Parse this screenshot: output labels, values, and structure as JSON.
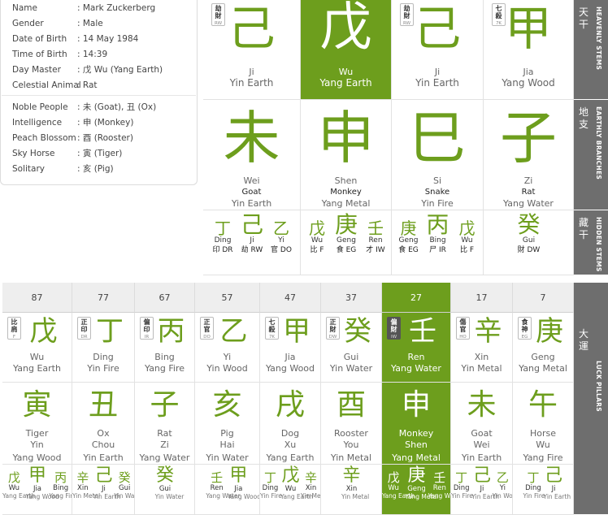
{
  "profile": [
    {
      "label": "Name",
      "value": ": Mark Zuckerberg"
    },
    {
      "label": "Gender",
      "value": ": Male"
    },
    {
      "label": "Date of Birth",
      "value": ": 14 May 1984"
    },
    {
      "label": "Time of Birth",
      "value": ": 14:39"
    },
    {
      "label": "Day Master",
      "value": ": 戊 Wu  (Yang Earth)"
    },
    {
      "label": "Celestial Animal",
      "value": ": Rat"
    }
  ],
  "stars": [
    {
      "label": "Noble People",
      "value": ": 未 (Goat),  丑 (Ox)"
    },
    {
      "label": "Intelligence",
      "value": ": 申 (Monkey)"
    },
    {
      "label": "Peach Blossom",
      "value": ": 酉 (Rooster)"
    },
    {
      "label": "Sky Horse",
      "value": ": 寅 (Tiger)"
    },
    {
      "label": "Solitary",
      "value": ": 亥 (Pig)"
    }
  ],
  "sidebar": {
    "heavenly": {
      "cjk": "天干",
      "en": "HEAVENLY STEMS"
    },
    "earthly": {
      "cjk": "地支",
      "en": "EARTHLY BRANCHES"
    },
    "hidden": {
      "cjk": "藏干",
      "en": "HIDDEN STEMS"
    },
    "luck": {
      "cjk": "大運",
      "en": "LUCK PILLARS"
    }
  },
  "heavenly_stems": [
    {
      "char": "己",
      "pinyin": "Ji",
      "element": "Yin Earth",
      "badge": {
        "c": "劫財",
        "s": "RW"
      }
    },
    {
      "char": "戊",
      "pinyin": "Wu",
      "element": "Yang Earth",
      "highlight": true
    },
    {
      "char": "己",
      "pinyin": "Ji",
      "element": "Yin Earth",
      "badge": {
        "c": "劫財",
        "s": "RW"
      }
    },
    {
      "char": "甲",
      "pinyin": "Jia",
      "element": "Yang Wood",
      "badge": {
        "c": "七殺",
        "s": "7K"
      }
    }
  ],
  "earthly_branches": [
    {
      "char": "未",
      "pinyin": "Wei",
      "animal": "Goat",
      "element": "Yin Earth"
    },
    {
      "char": "申",
      "pinyin": "Shen",
      "animal": "Monkey",
      "element": "Yang Metal"
    },
    {
      "char": "巳",
      "pinyin": "Si",
      "animal": "Snake",
      "element": "Yin Fire"
    },
    {
      "char": "子",
      "pinyin": "Zi",
      "animal": "Rat",
      "element": "Yang Water"
    }
  ],
  "hidden_stems": [
    [
      {
        "char": "丁",
        "pinyin": "Ding",
        "god": "印 DR"
      },
      {
        "char": "己",
        "pinyin": "Ji",
        "god": "劫 RW"
      },
      {
        "char": "乙",
        "pinyin": "Yi",
        "god": "官 DO"
      }
    ],
    [
      {
        "char": "戊",
        "pinyin": "Wu",
        "god": "比 F"
      },
      {
        "char": "庚",
        "pinyin": "Geng",
        "god": "食 EG"
      },
      {
        "char": "壬",
        "pinyin": "Ren",
        "god": "才 IW"
      }
    ],
    [
      {
        "char": "庚",
        "pinyin": "Geng",
        "god": "食 EG"
      },
      {
        "char": "丙",
        "pinyin": "Bing",
        "god": "尸 IR"
      },
      {
        "char": "戊",
        "pinyin": "Wu",
        "god": "比 F"
      }
    ],
    [
      {
        "char": "癸",
        "pinyin": "Gui",
        "god": "財 DW"
      }
    ]
  ],
  "luck_pillars": [
    {
      "age": "87",
      "stem": {
        "char": "戊",
        "pinyin": "Wu",
        "element": "Yang Earth",
        "badge": {
          "c": "比肩",
          "s": "F"
        }
      },
      "branch": {
        "char": "寅",
        "animal": "Tiger",
        "pinyin": "Yin",
        "element": "Yang Wood"
      },
      "hidden": [
        {
          "char": "戊",
          "pinyin": "Wu",
          "element": "Yang Earth"
        },
        {
          "char": "甲",
          "pinyin": "Jia",
          "element": "Yang Wood"
        },
        {
          "char": "丙",
          "pinyin": "Bing",
          "element": "Yang Fire"
        }
      ]
    },
    {
      "age": "77",
      "stem": {
        "char": "丁",
        "pinyin": "Ding",
        "element": "Yin Fire",
        "badge": {
          "c": "正印",
          "s": "DR"
        }
      },
      "branch": {
        "char": "丑",
        "animal": "Ox",
        "pinyin": "Chou",
        "element": "Yin Earth"
      },
      "hidden": [
        {
          "char": "辛",
          "pinyin": "Xin",
          "element": "Yin Metal"
        },
        {
          "char": "己",
          "pinyin": "Ji",
          "element": "Yin Earth"
        },
        {
          "char": "癸",
          "pinyin": "Gui",
          "element": "Yin Water"
        }
      ]
    },
    {
      "age": "67",
      "stem": {
        "char": "丙",
        "pinyin": "Bing",
        "element": "Yang Fire",
        "badge": {
          "c": "偏印",
          "s": "IR"
        }
      },
      "branch": {
        "char": "子",
        "animal": "Rat",
        "pinyin": "Zi",
        "element": "Yang Water"
      },
      "hidden": [
        {
          "char": "癸",
          "pinyin": "Gui",
          "element": "Yin Water"
        }
      ]
    },
    {
      "age": "57",
      "stem": {
        "char": "乙",
        "pinyin": "Yi",
        "element": "Yin Wood",
        "badge": {
          "c": "正官",
          "s": "DO"
        }
      },
      "branch": {
        "char": "亥",
        "animal": "Pig",
        "pinyin": "Hai",
        "element": "Yin Water"
      },
      "hidden": [
        {
          "char": "壬",
          "pinyin": "Ren",
          "element": "Yang Water"
        },
        {
          "char": "甲",
          "pinyin": "Jia",
          "element": "Yang Wood"
        }
      ]
    },
    {
      "age": "47",
      "stem": {
        "char": "甲",
        "pinyin": "Jia",
        "element": "Yang Wood",
        "badge": {
          "c": "七殺",
          "s": "7K"
        }
      },
      "branch": {
        "char": "戌",
        "animal": "Dog",
        "pinyin": "Xu",
        "element": "Yang Earth"
      },
      "hidden": [
        {
          "char": "丁",
          "pinyin": "Ding",
          "element": "Yin Fire"
        },
        {
          "char": "戊",
          "pinyin": "Wu",
          "element": "Yang Earth"
        },
        {
          "char": "辛",
          "pinyin": "Xin",
          "element": "Yin Metal"
        }
      ]
    },
    {
      "age": "37",
      "stem": {
        "char": "癸",
        "pinyin": "Gui",
        "element": "Yin Water",
        "badge": {
          "c": "正財",
          "s": "DW"
        }
      },
      "branch": {
        "char": "酉",
        "animal": "Rooster",
        "pinyin": "You",
        "element": "Yin Metal"
      },
      "hidden": [
        {
          "char": "辛",
          "pinyin": "Xin",
          "element": "Yin Metal"
        }
      ]
    },
    {
      "age": "27",
      "highlight": true,
      "stem": {
        "char": "壬",
        "pinyin": "Ren",
        "element": "Yang Water",
        "badge": {
          "c": "偏財",
          "s": "IW"
        }
      },
      "branch": {
        "char": "申",
        "animal": "Monkey",
        "pinyin": "Shen",
        "element": "Yang Metal"
      },
      "hidden": [
        {
          "char": "戊",
          "pinyin": "Wu",
          "element": "Yang Earth"
        },
        {
          "char": "庚",
          "pinyin": "Geng",
          "element": "Yang Metal"
        },
        {
          "char": "壬",
          "pinyin": "Ren",
          "element": "Yang Water"
        }
      ]
    },
    {
      "age": "17",
      "stem": {
        "char": "辛",
        "pinyin": "Xin",
        "element": "Yin Metal",
        "badge": {
          "c": "傷官",
          "s": "HO"
        }
      },
      "branch": {
        "char": "未",
        "animal": "Goat",
        "pinyin": "Wei",
        "element": "Yin Earth"
      },
      "hidden": [
        {
          "char": "丁",
          "pinyin": "Ding",
          "element": "Yin Fire"
        },
        {
          "char": "己",
          "pinyin": "Ji",
          "element": "Yin Earth"
        },
        {
          "char": "乙",
          "pinyin": "Yi",
          "element": "Yin Wood"
        }
      ]
    },
    {
      "age": "7",
      "stem": {
        "char": "庚",
        "pinyin": "Geng",
        "element": "Yang Metal",
        "badge": {
          "c": "食神",
          "s": "EG"
        }
      },
      "branch": {
        "char": "午",
        "animal": "Horse",
        "pinyin": "Wu",
        "element": "Yang Fire"
      },
      "hidden": [
        {
          "char": "丁",
          "pinyin": "Ding",
          "element": "Yin Fire"
        },
        {
          "char": "己",
          "pinyin": "Ji",
          "element": "Yin Earth"
        }
      ]
    }
  ]
}
